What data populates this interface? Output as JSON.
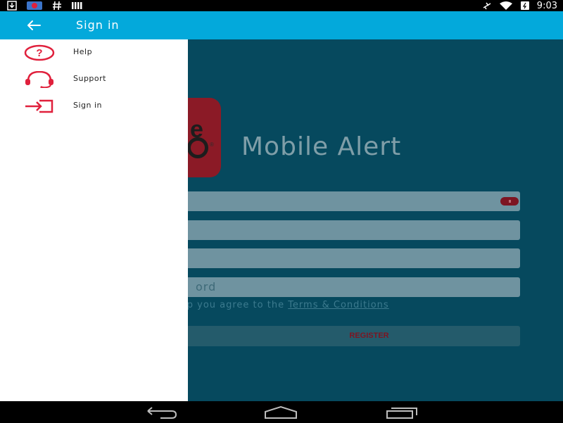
{
  "status_bar": {
    "time": "9:03",
    "icons": [
      "download-icon",
      "notification-app-icon",
      "hash-icon",
      "signal-bars-icon",
      "airplane-icon",
      "wifi-icon",
      "battery-icon"
    ]
  },
  "app_bar": {
    "title": "Sign in",
    "back_icon": "arrow-left-icon"
  },
  "drawer": {
    "items": [
      {
        "label": "Help",
        "icon": "help-circle-icon"
      },
      {
        "label": "Support",
        "icon": "headset-icon"
      },
      {
        "label": "Sign in",
        "icon": "sign-in-icon"
      }
    ]
  },
  "background": {
    "app_title": "Mobile Alert",
    "field_4_placeholder_visible": "ord",
    "terms_prefix": "is app you agree to the ",
    "terms_link": "Terms & Conditions",
    "register_label": "REGISTER"
  },
  "nav_bar": {
    "buttons": [
      "back-nav-icon",
      "home-nav-icon",
      "recents-nav-icon"
    ]
  },
  "colors": {
    "app_bar": "#03a9db",
    "background": "#06495e",
    "accent": "#e0203c",
    "drawer": "#ffffff"
  }
}
